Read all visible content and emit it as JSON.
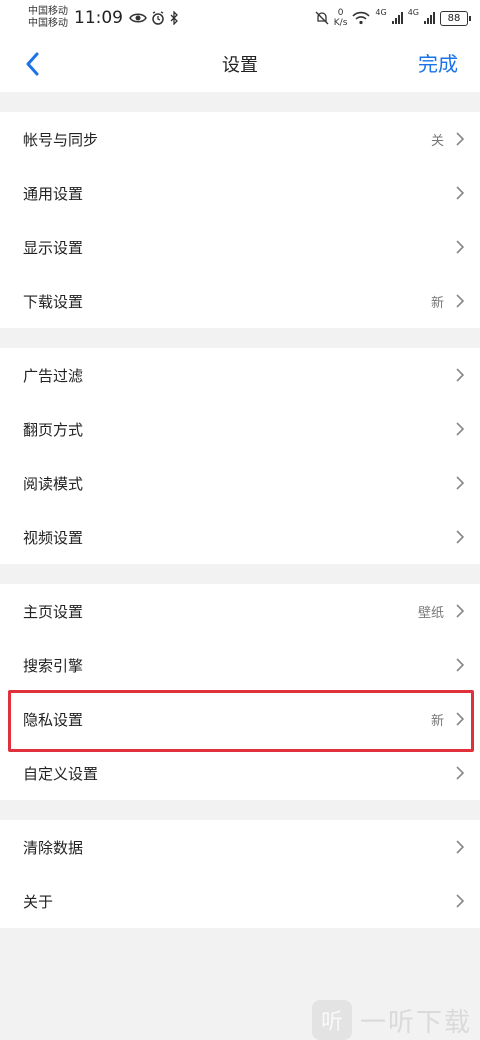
{
  "status_bar": {
    "carrier_1": "中国移动",
    "carrier_2": "中国移动",
    "time": "11:09",
    "speed_value": "0",
    "speed_unit": "K/s",
    "net_1": "4G",
    "net_2": "4G",
    "battery": "88"
  },
  "header": {
    "title": "设置",
    "done_label": "完成"
  },
  "groups": [
    {
      "items": [
        {
          "label": "帐号与同步",
          "value": "关"
        },
        {
          "label": "通用设置",
          "value": ""
        },
        {
          "label": "显示设置",
          "value": ""
        },
        {
          "label": "下载设置",
          "value": "新"
        }
      ]
    },
    {
      "items": [
        {
          "label": "广告过滤",
          "value": ""
        },
        {
          "label": "翻页方式",
          "value": ""
        },
        {
          "label": "阅读模式",
          "value": ""
        },
        {
          "label": "视频设置",
          "value": ""
        }
      ]
    },
    {
      "items": [
        {
          "label": "主页设置",
          "value": "壁纸"
        },
        {
          "label": "搜索引擎",
          "value": ""
        },
        {
          "label": "隐私设置",
          "value": "新"
        },
        {
          "label": "自定义设置",
          "value": ""
        }
      ]
    },
    {
      "items": [
        {
          "label": "清除数据",
          "value": ""
        },
        {
          "label": "关于",
          "value": ""
        }
      ]
    }
  ],
  "watermark": {
    "logo_char": "听",
    "text": "一听下载"
  },
  "colors": {
    "accent": "#1a73e8",
    "highlight": "#e0303c"
  }
}
